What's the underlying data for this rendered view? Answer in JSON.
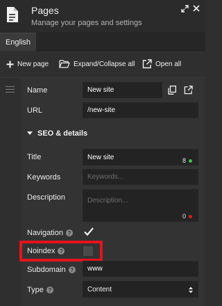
{
  "header": {
    "title": "Pages",
    "subtitle": "Manage your pages and settings",
    "icons": {
      "page": "document-icon",
      "expand": "expand-icon",
      "close": "close-icon"
    }
  },
  "language": {
    "active_tab": "English"
  },
  "toolbar": {
    "new_page_label": "New page",
    "expand_collapse_label": "Expand/Collapse all",
    "open_all_label": "Open all"
  },
  "form": {
    "name": {
      "label": "Name",
      "value": "New site"
    },
    "url": {
      "label": "URL",
      "value": "/new-site"
    },
    "seo_section": {
      "label": "SEO & details"
    },
    "title": {
      "label": "Title",
      "value": "New site",
      "count": "8",
      "count_color": "#3fbf4f"
    },
    "keywords": {
      "label": "Keywords",
      "placeholder": "Keywords..."
    },
    "description": {
      "label": "Description",
      "placeholder": "Description...",
      "count": "0",
      "count_color": "#d02020"
    },
    "navigation": {
      "label": "Navigation",
      "checked": true
    },
    "noindex": {
      "label": "Noindex",
      "checked": false
    },
    "subdomain": {
      "label": "Subdomain",
      "value": "www"
    },
    "type": {
      "label": "Type",
      "value": "Content"
    }
  },
  "colors": {
    "highlight": "#e3141e"
  }
}
